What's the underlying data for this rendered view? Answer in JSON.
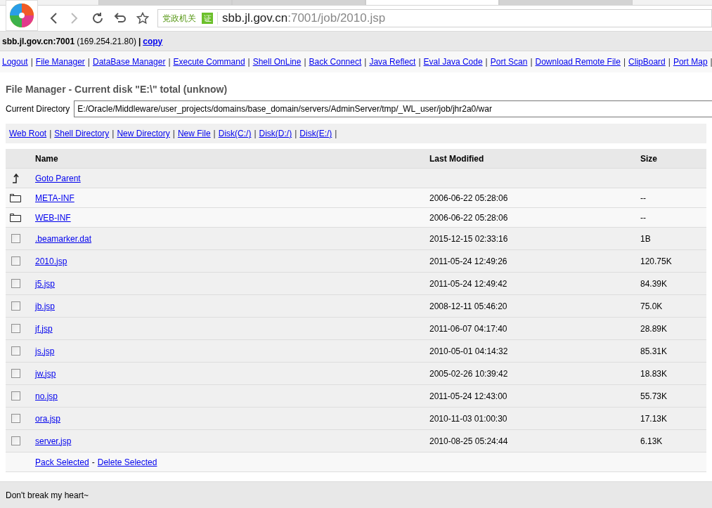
{
  "browser": {
    "tabs": [
      {
        "selected": false
      },
      {
        "selected": false
      },
      {
        "selected": true
      },
      {
        "selected": false
      }
    ],
    "security_badge": "党政机关",
    "cert_mark": "证",
    "url_host": "sbb.jl.gov.cn",
    "url_rest": ":7001/job/2010.jsp"
  },
  "header": {
    "host": "sbb.jl.gov.cn:7001",
    "ip": "(169.254.21.80)",
    "separator": "|",
    "copy_link": "copy"
  },
  "nav": {
    "separator": "|",
    "links": [
      "Logout",
      "File Manager",
      "DataBase Manager",
      "Execute Command",
      "Shell OnLine",
      "Back Connect",
      "Java Reflect",
      "Eval Java Code",
      "Port Scan",
      "Download Remote File",
      "ClipBoard",
      "Port Map"
    ]
  },
  "title": "File Manager - Current disk \"E:\\\" total (unknow)",
  "current_directory": {
    "label": "Current Directory",
    "value": "E:/Oracle/Middleware/user_projects/domains/base_domain/servers/AdminServer/tmp/_WL_user/job/jhr2a0/war"
  },
  "quick_links": {
    "separator": "|",
    "links": [
      "Web Root",
      "Shell Directory",
      "New Directory",
      "New File",
      "Disk(C:/)",
      "Disk(D:/)",
      "Disk(E:/)"
    ]
  },
  "table": {
    "columns": [
      "Name",
      "Last Modified",
      "Size"
    ],
    "rows": [
      {
        "kind": "parent",
        "name": "Goto Parent"
      },
      {
        "kind": "folder",
        "name": "META-INF",
        "modified": "2006-06-22 05:28:06",
        "size": "--"
      },
      {
        "kind": "folder",
        "name": "WEB-INF",
        "modified": "2006-06-22 05:28:06",
        "size": "--"
      },
      {
        "kind": "file",
        "checked": false,
        "name": ".beamarker.dat",
        "modified": "2015-12-15 02:33:16",
        "size": "1B"
      },
      {
        "kind": "file",
        "checked": false,
        "name": "2010.jsp",
        "modified": "2011-05-24 12:49:26",
        "size": "120.75K"
      },
      {
        "kind": "file",
        "checked": false,
        "name": "j5.jsp",
        "modified": "2011-05-24 12:49:42",
        "size": "84.39K"
      },
      {
        "kind": "file",
        "checked": false,
        "name": "jb.jsp",
        "modified": "2008-12-11 05:46:20",
        "size": "75.0K"
      },
      {
        "kind": "file",
        "checked": false,
        "name": "jf.jsp",
        "modified": "2011-06-07 04:17:40",
        "size": "28.89K"
      },
      {
        "kind": "file",
        "checked": false,
        "name": "js.jsp",
        "modified": "2010-05-01 04:14:32",
        "size": "85.31K"
      },
      {
        "kind": "file",
        "checked": false,
        "name": "jw.jsp",
        "modified": "2005-02-26 10:39:42",
        "size": "18.83K"
      },
      {
        "kind": "file",
        "checked": false,
        "name": "no.jsp",
        "modified": "2011-05-24 12:43:00",
        "size": "55.73K"
      },
      {
        "kind": "file",
        "checked": false,
        "name": "ora.jsp",
        "modified": "2010-11-03 01:00:30",
        "size": "17.13K"
      },
      {
        "kind": "file",
        "checked": false,
        "name": "server.jsp",
        "modified": "2010-08-25 05:24:44",
        "size": "6.13K"
      }
    ],
    "actions": {
      "pack": "Pack Selected",
      "separator": "-",
      "delete": "Delete Selected"
    }
  },
  "footer": "Don't break my heart~"
}
